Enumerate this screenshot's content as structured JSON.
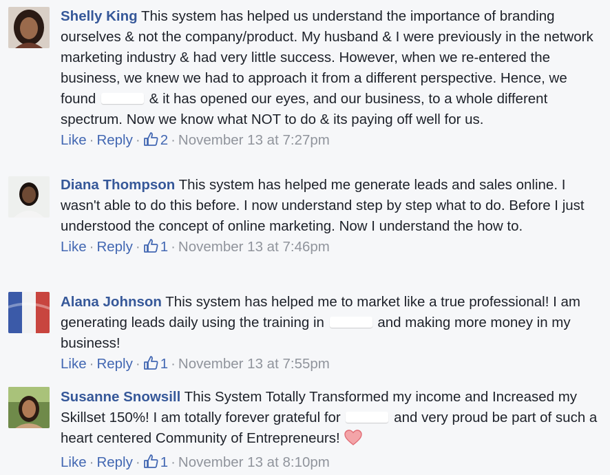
{
  "comments": [
    {
      "name": "Shelly King",
      "text_a": "This system has helped us understand the importance of branding ourselves & not the company/product. My husband & I were previously in the network marketing industry & had very little success. However, when we re-entered the business, we knew we had to approach it from a different perspective. Hence, we found",
      "text_b": "& it has opened our eyes, and our business, to a whole different spectrum. Now we know what NOT to do & its paying off well for us.",
      "like": "Like",
      "reply": "Reply",
      "like_count": "2",
      "timestamp": "November 13 at 7:27pm"
    },
    {
      "name": "Diana Thompson",
      "text_a": "This system has helped me generate leads and sales online. I wasn't able to do this before. I now understand step by step what to do. Before I just understood the concept of online marketing. Now I understand the how to.",
      "like": "Like",
      "reply": "Reply",
      "like_count": "1",
      "timestamp": "November 13 at 7:46pm"
    },
    {
      "name": "Alana Johnson",
      "text_a": "This system has helped me to market like a true professional! I am generating leads daily using the training in",
      "text_b": "and making more money in my business!",
      "like": "Like",
      "reply": "Reply",
      "like_count": "1",
      "timestamp": "November 13 at 7:55pm"
    },
    {
      "name": "Susanne Snowsill",
      "text_a": "This System Totally Transformed my income and Increased my Skillset 150%! I am totally forever grateful for",
      "text_b": "and very proud be part of such a heart centered Community of Entrepreneurs!",
      "like": "Like",
      "reply": "Reply",
      "like_count": "1",
      "timestamp": "November 13 at 8:10pm"
    }
  ],
  "colors": {
    "name": "#365899",
    "link": "#4267b2",
    "meta": "#90949c",
    "text": "#1d2129",
    "heart": "#f0888f"
  },
  "icons": {
    "like_count": "thumbs-up-icon",
    "emoji": "heart-icon"
  }
}
